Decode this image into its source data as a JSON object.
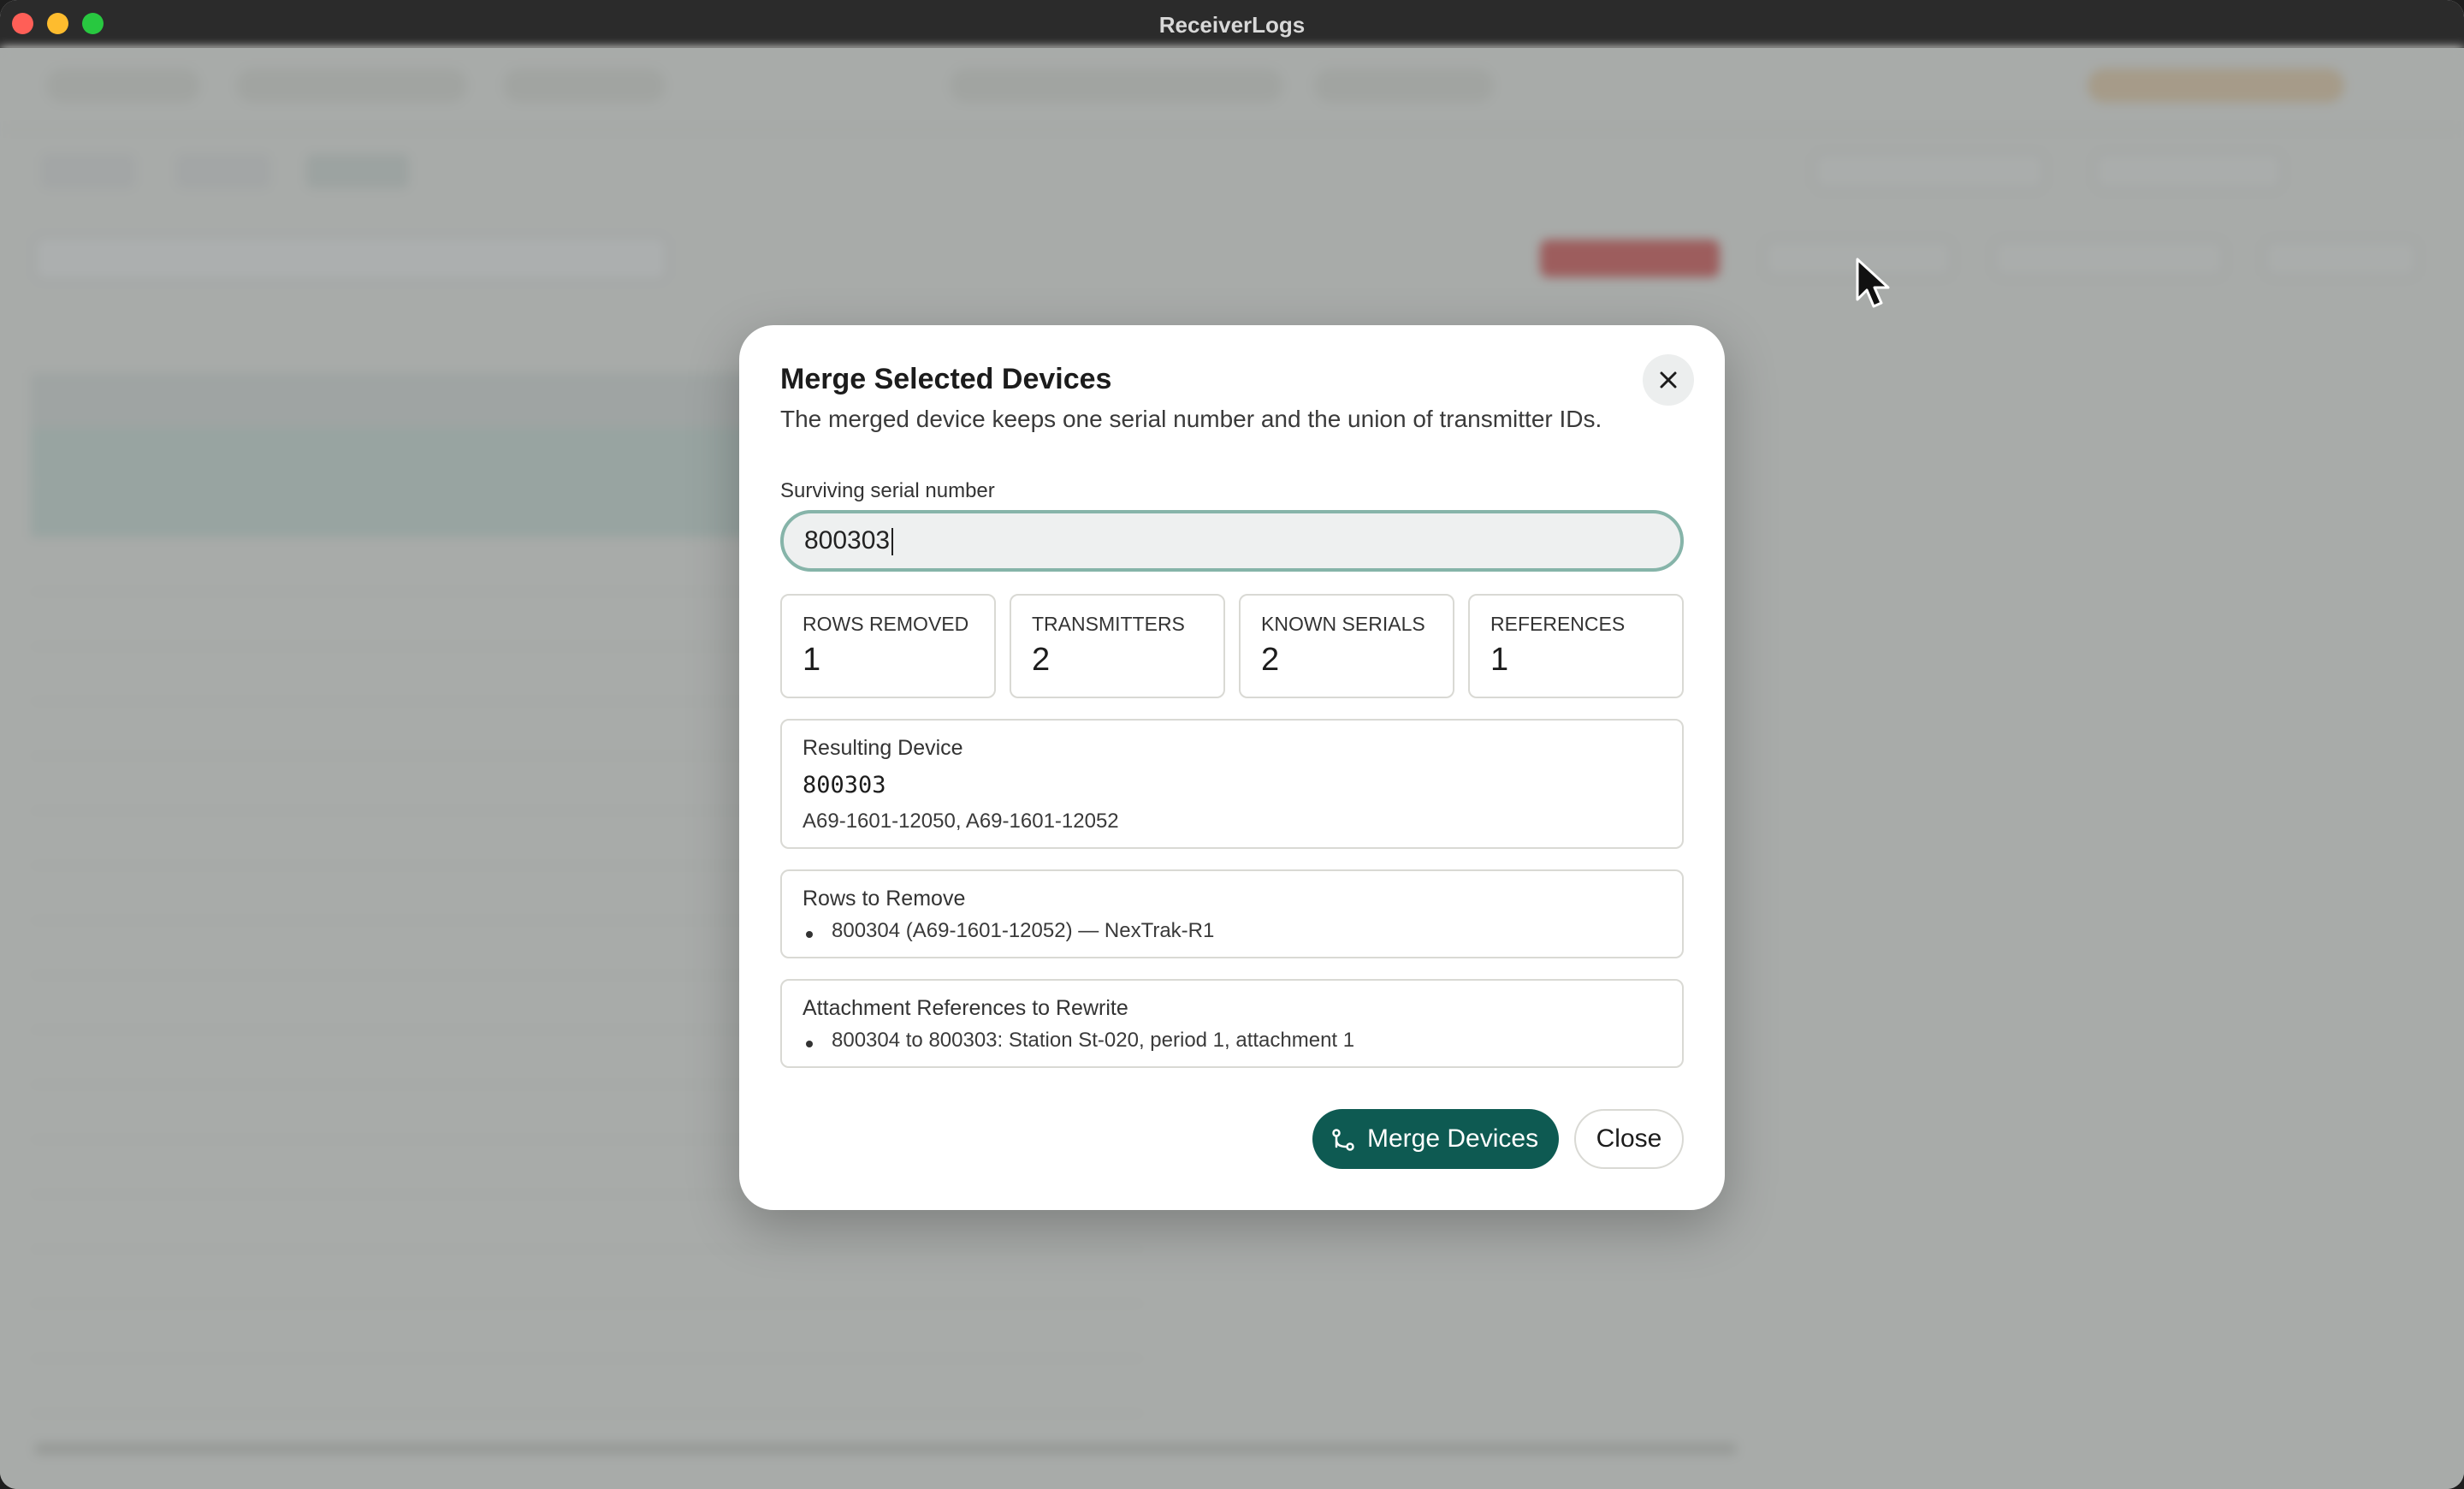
{
  "window": {
    "title": "ReceiverLogs"
  },
  "dialog": {
    "title": "Merge Selected Devices",
    "subtitle": "The merged device keeps one serial number and the union of transmitter IDs.",
    "serial_label": "Surviving serial number",
    "serial_value": "800303",
    "stats": [
      {
        "label": "ROWS REMOVED",
        "value": "1"
      },
      {
        "label": "TRANSMITTERS",
        "value": "2"
      },
      {
        "label": "KNOWN SERIALS",
        "value": "2"
      },
      {
        "label": "REFERENCES",
        "value": "1"
      }
    ],
    "resulting": {
      "title": "Resulting Device",
      "serial": "800303",
      "transmitters": "A69-1601-12050, A69-1601-12052"
    },
    "remove": {
      "title": "Rows to Remove",
      "items": [
        "800304 (A69-1601-12052) — NexTrak-R1"
      ]
    },
    "references": {
      "title": "Attachment References to Rewrite",
      "items": [
        "800304 to 800303: Station St-020, period 1, attachment 1"
      ]
    },
    "merge_label": "Merge Devices",
    "close_label": "Close"
  },
  "icons": {
    "close": "close-icon",
    "merge": "merge-icon",
    "cursor": "mouse-pointer-icon"
  },
  "colors": {
    "accent": "#0e5a52",
    "focus_ring": "#86b4a9",
    "overlay": "rgba(90,96,96,0.5)"
  }
}
